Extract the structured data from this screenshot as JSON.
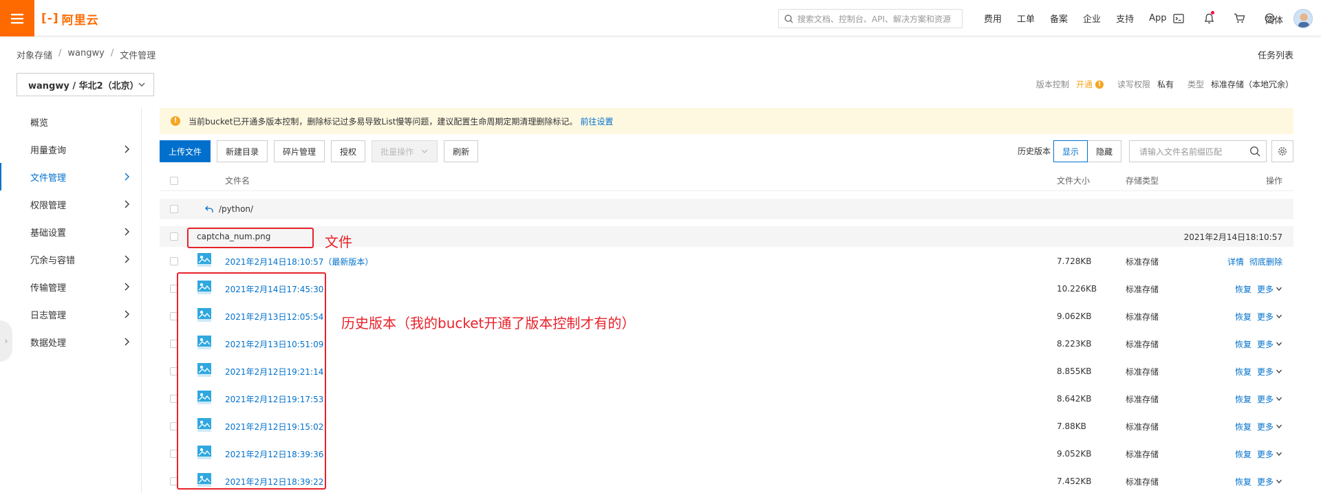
{
  "topbar": {
    "logo": "阿里云",
    "search_placeholder": "搜索文档、控制台、API、解决方案和资源",
    "nav": [
      "费用",
      "工单",
      "备案",
      "企业",
      "支持",
      "App"
    ],
    "lang": "简体"
  },
  "breadcrumb": [
    "对象存储",
    "wangwy",
    "文件管理"
  ],
  "tasklist": "任务列表",
  "bucket": {
    "selector": "wangwy / 华北2（北京）",
    "version_label": "版本控制",
    "version_value": "开通",
    "acl_label": "读写权限",
    "acl_value": "私有",
    "type_label": "类型",
    "type_value": "标准存储（本地冗余）"
  },
  "sidebar": {
    "items": [
      {
        "label": "概览"
      },
      {
        "label": "用量查询"
      },
      {
        "label": "文件管理"
      },
      {
        "label": "权限管理"
      },
      {
        "label": "基础设置"
      },
      {
        "label": "冗余与容错"
      },
      {
        "label": "传输管理"
      },
      {
        "label": "日志管理"
      },
      {
        "label": "数据处理"
      }
    ]
  },
  "notice": {
    "text": "当前bucket已开通多版本控制，删除标记过多易导致List慢等问题，建议配置生命周期定期清理删除标记。",
    "link": "前往设置"
  },
  "toolbar": {
    "upload": "上传文件",
    "new_dir": "新建目录",
    "fragments": "碎片管理",
    "auth": "授权",
    "batch": "批量操作",
    "refresh": "刷新",
    "history_label": "历史版本",
    "show": "显示",
    "hide": "隐藏",
    "filter_placeholder": "请输入文件名前缀匹配"
  },
  "table": {
    "headers": {
      "name": "文件名",
      "size": "文件大小",
      "type": "存储类型",
      "ops": "操作"
    },
    "parent": "/python/",
    "file": {
      "name": "captcha_num.png",
      "time": "2021年2月14日18:10:57"
    },
    "versions": [
      {
        "time": "2021年2月14日18:10:57",
        "tag": "（最新版本）",
        "size": "7.728KB",
        "type": "标准存储",
        "op1": "详情",
        "op2": "彻底删除"
      },
      {
        "time": "2021年2月14日17:45:30",
        "tag": "",
        "size": "10.226KB",
        "type": "标准存储",
        "op1": "恢复",
        "op2": "更多"
      },
      {
        "time": "2021年2月13日12:05:54",
        "tag": "",
        "size": "9.062KB",
        "type": "标准存储",
        "op1": "恢复",
        "op2": "更多"
      },
      {
        "time": "2021年2月13日10:51:09",
        "tag": "",
        "size": "8.223KB",
        "type": "标准存储",
        "op1": "恢复",
        "op2": "更多"
      },
      {
        "time": "2021年2月12日19:21:14",
        "tag": "",
        "size": "8.855KB",
        "type": "标准存储",
        "op1": "恢复",
        "op2": "更多"
      },
      {
        "time": "2021年2月12日19:17:53",
        "tag": "",
        "size": "8.642KB",
        "type": "标准存储",
        "op1": "恢复",
        "op2": "更多"
      },
      {
        "time": "2021年2月12日19:15:02",
        "tag": "",
        "size": "7.88KB",
        "type": "标准存储",
        "op1": "恢复",
        "op2": "更多"
      },
      {
        "time": "2021年2月12日18:39:36",
        "tag": "",
        "size": "9.052KB",
        "type": "标准存储",
        "op1": "恢复",
        "op2": "更多"
      },
      {
        "time": "2021年2月12日18:39:22",
        "tag": "",
        "size": "7.452KB",
        "type": "标准存储",
        "op1": "恢复",
        "op2": "更多"
      }
    ]
  },
  "annotations": {
    "file_label": "文件",
    "history_label": "历史版本（我的bucket开通了版本控制才有的）"
  },
  "colors": {
    "brand": "#ff6a00",
    "primary": "#0070cc",
    "annotation": "#e8212a"
  }
}
